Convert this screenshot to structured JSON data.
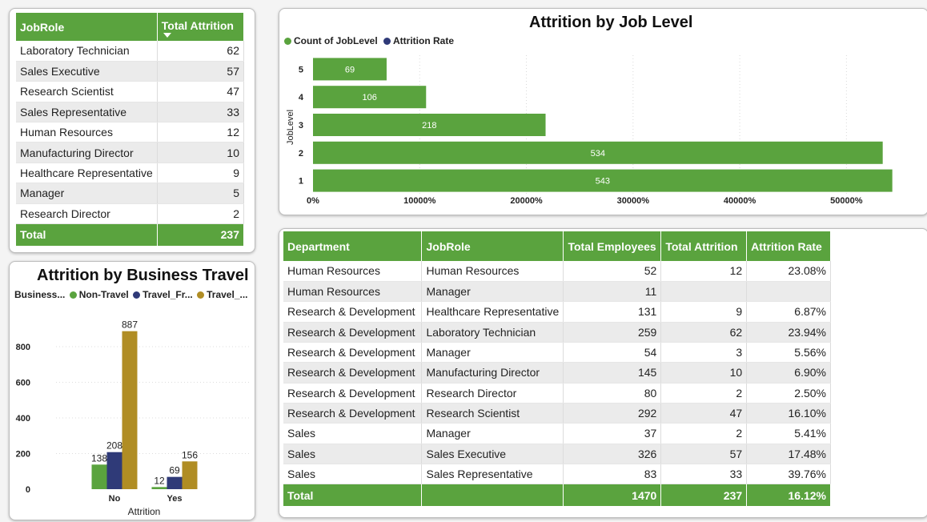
{
  "colors": {
    "green": "#5aa33e",
    "navy": "#2f3a78",
    "gold": "#b08d24"
  },
  "jobrole_table": {
    "headers": [
      "JobRole",
      "Total Attrition"
    ],
    "rows": [
      [
        "Laboratory Technician",
        "62"
      ],
      [
        "Sales Executive",
        "57"
      ],
      [
        "Research Scientist",
        "47"
      ],
      [
        "Sales Representative",
        "33"
      ],
      [
        "Human Resources",
        "12"
      ],
      [
        "Manufacturing Director",
        "10"
      ],
      [
        "Healthcare Representative",
        "9"
      ],
      [
        "Manager",
        "5"
      ],
      [
        "Research Director",
        "2"
      ]
    ],
    "total_label": "Total",
    "total_value": "237",
    "sort_icon": "sort-descending-icon"
  },
  "job_level_chart": {
    "title": "Attrition by Job Level",
    "legend": [
      "Count of JobLevel",
      "Attrition Rate"
    ],
    "chart_data": {
      "type": "bar",
      "orientation": "horizontal",
      "title": "Attrition by Job Level",
      "ylabel": "JobLevel",
      "categories": [
        "5",
        "4",
        "3",
        "2",
        "1"
      ],
      "series": [
        {
          "name": "Count of JobLevel",
          "values": [
            69,
            106,
            218,
            534,
            543
          ]
        }
      ],
      "xticks": [
        "0%",
        "10000%",
        "20000%",
        "30000%",
        "40000%",
        "50000%"
      ],
      "xlim": [
        0,
        55000
      ],
      "value_scale": 100,
      "grid": true
    }
  },
  "business_travel_chart": {
    "title": "Attrition by Business Travel",
    "legend_title": "Business...",
    "legend": [
      "Non-Travel",
      "Travel_Fr...",
      "Travel_..."
    ],
    "chart_data": {
      "type": "bar",
      "title": "Attrition by Business Travel",
      "xlabel": "Attrition",
      "categories": [
        "No",
        "Yes"
      ],
      "series": [
        {
          "name": "Non-Travel",
          "values": [
            138,
            12
          ]
        },
        {
          "name": "Travel_Fr...",
          "values": [
            208,
            69
          ]
        },
        {
          "name": "Travel_...",
          "values": [
            887,
            156
          ]
        }
      ],
      "yticks": [
        "0",
        "200",
        "400",
        "600",
        "800"
      ],
      "ylim": [
        0,
        900
      ],
      "grid": true
    }
  },
  "dept_table": {
    "headers": [
      "Department",
      "JobRole",
      "Total Employees",
      "Total Attrition",
      "Attrition Rate"
    ],
    "rows": [
      [
        "Human Resources",
        "Human Resources",
        "52",
        "12",
        "23.08%"
      ],
      [
        "Human Resources",
        "Manager",
        "11",
        "",
        ""
      ],
      [
        "Research & Development",
        "Healthcare Representative",
        "131",
        "9",
        "6.87%"
      ],
      [
        "Research & Development",
        "Laboratory Technician",
        "259",
        "62",
        "23.94%"
      ],
      [
        "Research & Development",
        "Manager",
        "54",
        "3",
        "5.56%"
      ],
      [
        "Research & Development",
        "Manufacturing Director",
        "145",
        "10",
        "6.90%"
      ],
      [
        "Research & Development",
        "Research Director",
        "80",
        "2",
        "2.50%"
      ],
      [
        "Research & Development",
        "Research Scientist",
        "292",
        "47",
        "16.10%"
      ],
      [
        "Sales",
        "Manager",
        "37",
        "2",
        "5.41%"
      ],
      [
        "Sales",
        "Sales Executive",
        "326",
        "57",
        "17.48%"
      ],
      [
        "Sales",
        "Sales Representative",
        "83",
        "33",
        "39.76%"
      ]
    ],
    "total": [
      "Total",
      "",
      "1470",
      "237",
      "16.12%"
    ]
  }
}
